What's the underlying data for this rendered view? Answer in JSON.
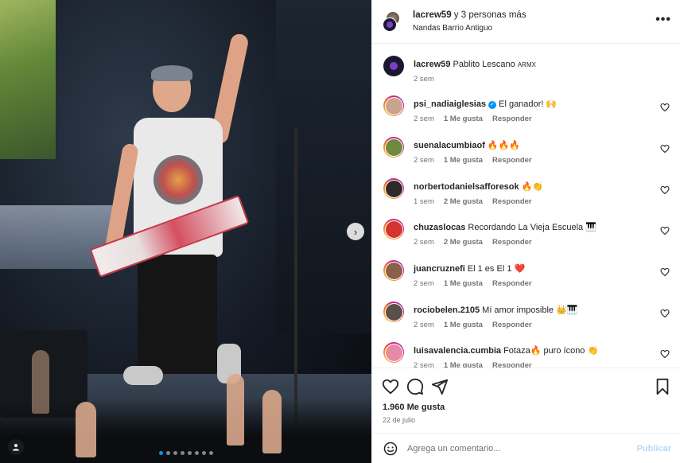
{
  "header": {
    "title_user": "lacrew59",
    "title_rest": " y 3 personas más",
    "subtitle": "Nandas Barrio Antiguo",
    "more_icon": "more-horizontal-icon"
  },
  "caption": {
    "user": "lacrew59",
    "text": "Pablito Lescano ",
    "text_small": "ARMX",
    "time": "2 sem"
  },
  "comments": [
    {
      "user": "psi_nadiaiglesias",
      "verified": true,
      "text": "El ganador! 🙌",
      "time": "2 sem",
      "likes": "1 Me gusta",
      "reply": "Responder",
      "avatar_color": "#c9a48d"
    },
    {
      "user": "suenalacumbiaof",
      "verified": false,
      "text": "🔥🔥🔥",
      "time": "2 sem",
      "likes": "1 Me gusta",
      "reply": "Responder",
      "avatar_color": "#6e8a3d"
    },
    {
      "user": "norbertodanielsafforesok",
      "verified": false,
      "text": "🔥👏",
      "time": "1 sem",
      "likes": "2 Me gusta",
      "reply": "Responder",
      "avatar_color": "#2d2a28"
    },
    {
      "user": "chuzaslocas",
      "verified": false,
      "text": "Recordando La Vieja Escuela 🎹",
      "time": "2 sem",
      "likes": "2 Me gusta",
      "reply": "Responder",
      "avatar_color": "#d4342f"
    },
    {
      "user": "juancruznefi",
      "verified": false,
      "text": "El 1 es El 1 ❤️",
      "time": "2 sem",
      "likes": "1 Me gusta",
      "reply": "Responder",
      "avatar_color": "#8a6048"
    },
    {
      "user": "rociobelen.2105",
      "verified": false,
      "text": "Mí amor imposible 👑🎹",
      "time": "2 sem",
      "likes": "1 Me gusta",
      "reply": "Responder",
      "avatar_color": "#5b4f49"
    },
    {
      "user": "luisavalencia.cumbia",
      "verified": false,
      "text": "Fotaza🔥 puro ícono 👏",
      "time": "2 sem",
      "likes": "1 Me gusta",
      "reply": "Responder",
      "avatar_color": "#e58aa8"
    }
  ],
  "actions": {
    "like_icon": "heart-outline-icon",
    "comment_icon": "comment-bubble-icon",
    "share_icon": "paper-plane-icon",
    "save_icon": "bookmark-icon",
    "likes_count": "1.960 Me gusta",
    "date": "22 de julio"
  },
  "add_comment": {
    "placeholder": "Agrega un comentario...",
    "post_label": "Publicar",
    "emoji_icon": "emoji-icon"
  },
  "colors": {
    "accent": "#0095f6",
    "post_disabled": "#b3dbff",
    "secondary_text": "#737373",
    "heart_red": "#ed4956"
  },
  "carousel": {
    "slides": 8,
    "active_index": 0,
    "next_icon": "chevron-right-icon",
    "tag_icon": "user-tag-icon"
  }
}
